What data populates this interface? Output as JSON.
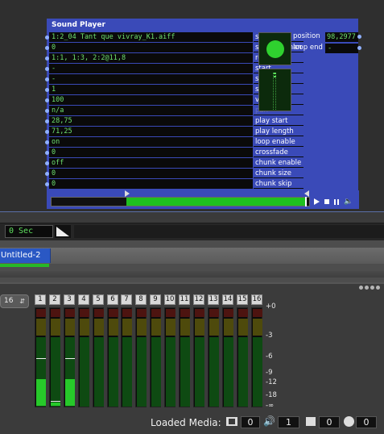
{
  "player": {
    "title": "Sound Player",
    "rows": [
      {
        "value": "1:2_04 Tant que vivray_K1.aiff",
        "label": "sound"
      },
      {
        "value": "0",
        "label": "sampler chan"
      },
      {
        "value": "1:1, 1:3, 2:2@11,8",
        "label": "routing"
      },
      {
        "value": "-",
        "label": "start"
      },
      {
        "value": "-",
        "label": "stop"
      },
      {
        "value": "1",
        "label": "speed"
      },
      {
        "value": "100",
        "label": "volume"
      },
      {
        "value": "n/a",
        "label": "pan"
      },
      {
        "value": "28,75",
        "label": "play start"
      },
      {
        "value": "71,25",
        "label": "play length"
      },
      {
        "value": "on",
        "label": "loop enable"
      },
      {
        "value": "0",
        "label": "crossfade"
      },
      {
        "value": "off",
        "label": "chunk enable"
      },
      {
        "value": "0",
        "label": "chunk size"
      },
      {
        "value": "0",
        "label": "chunk skip"
      }
    ],
    "position_label": "position",
    "position_value": "98,2977",
    "loop_end_label": "loop end",
    "loop_end_value": "-",
    "play_progress": 0.7
  },
  "time": {
    "value": "0 Sec"
  },
  "tab": {
    "label": "Untitled-2"
  },
  "mixer": {
    "channel_count": "16",
    "channels": [
      "1",
      "2",
      "3",
      "4",
      "5",
      "6",
      "7",
      "8",
      "9",
      "10",
      "11",
      "12",
      "13",
      "14",
      "15",
      "16"
    ],
    "levels": [
      0.27,
      0.03,
      0.27,
      0,
      0,
      0,
      0,
      0,
      0,
      0,
      0,
      0,
      0,
      0,
      0,
      0
    ],
    "peaks": [
      0.48,
      0.05,
      0.48,
      null,
      null,
      null,
      null,
      null,
      null,
      null,
      null,
      null,
      null,
      null,
      null,
      null
    ],
    "scale": [
      "+0",
      "-3",
      "-6",
      "-9",
      "-12",
      "-18",
      "-∞"
    ]
  },
  "status": {
    "loaded_media_label": "Loaded Media:",
    "video_count": "0",
    "audio_count": "1",
    "image_count": "0",
    "other_count": "0"
  }
}
